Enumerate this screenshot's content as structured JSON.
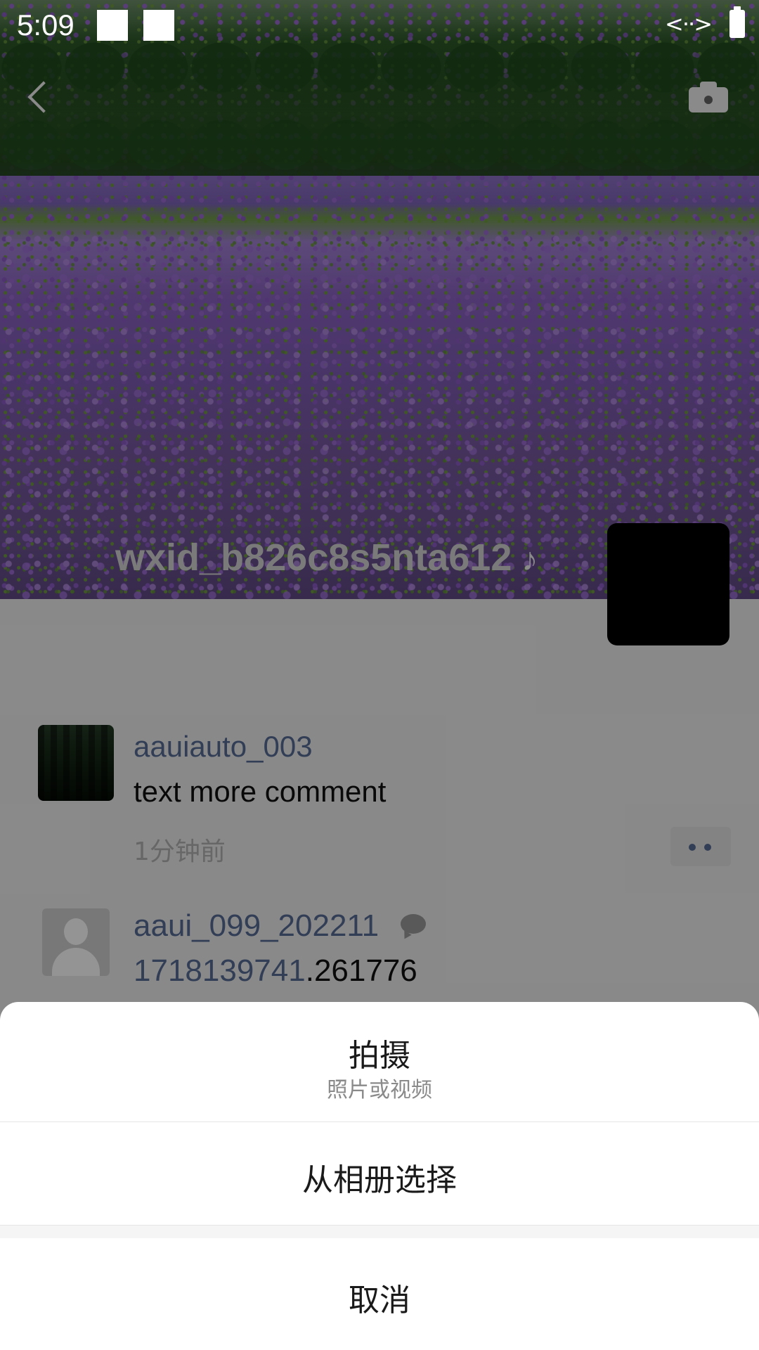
{
  "status_bar": {
    "time": "5:09",
    "data_icon": "<··>"
  },
  "header": {
    "back_icon": "chevron-left-icon",
    "camera_icon": "camera-icon"
  },
  "profile": {
    "name": "wxid_b826c8s5nta612",
    "music_icon": "♪"
  },
  "comment": {
    "user": "aauiauto_003",
    "text": "text more comment",
    "time": "1分钟前"
  },
  "item2": {
    "user": "aaui_099_202211",
    "text_num": "1718139741",
    "text_rest": ".261776"
  },
  "action_sheet": {
    "option1_title": "拍摄",
    "option1_subtitle": "照片或视频",
    "option2_label": "从相册选择",
    "cancel_label": "取消"
  }
}
